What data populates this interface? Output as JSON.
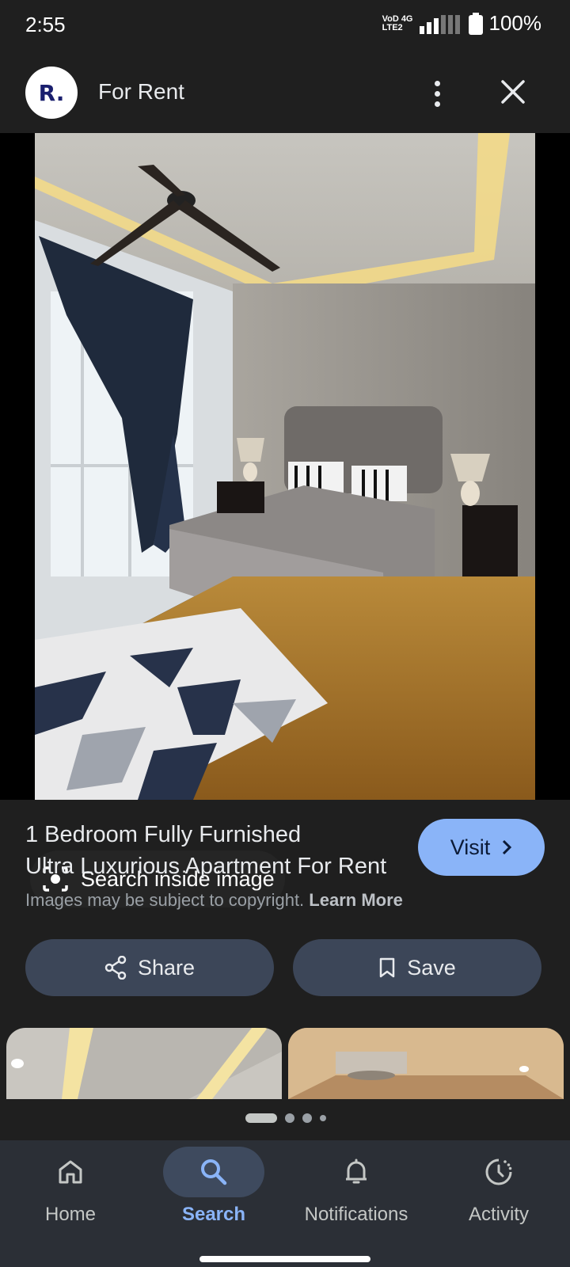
{
  "status_bar": {
    "time": "2:55",
    "network_top": "VoD 4G",
    "network_bottom": "LTE2",
    "battery": "100%"
  },
  "top_bar": {
    "logo_text": "R.",
    "title": "For Rent"
  },
  "image": {
    "search_inside_label": "Search inside image"
  },
  "result": {
    "title_line1": "1 Bedroom Fully Furnished",
    "title_line2": "Ultra Luxurious Apartment For Rent",
    "visit_label": "Visit",
    "copyright_text": "Images may be subject to copyright.",
    "learn_more": "Learn More",
    "share_label": "Share",
    "save_label": "Save"
  },
  "pager": {
    "count": 4,
    "active_index": 0
  },
  "bottom_nav": {
    "items": [
      {
        "label": "Home",
        "icon": "home-icon",
        "active": false
      },
      {
        "label": "Search",
        "icon": "search-icon",
        "active": true
      },
      {
        "label": "Notifications",
        "icon": "bell-icon",
        "active": false
      },
      {
        "label": "Activity",
        "icon": "activity-icon",
        "active": false
      }
    ]
  },
  "colors": {
    "background": "#1f1f1f",
    "accent": "#8ab4f8",
    "button_bg": "#3c4658",
    "nav_bg": "#2b2f36"
  }
}
